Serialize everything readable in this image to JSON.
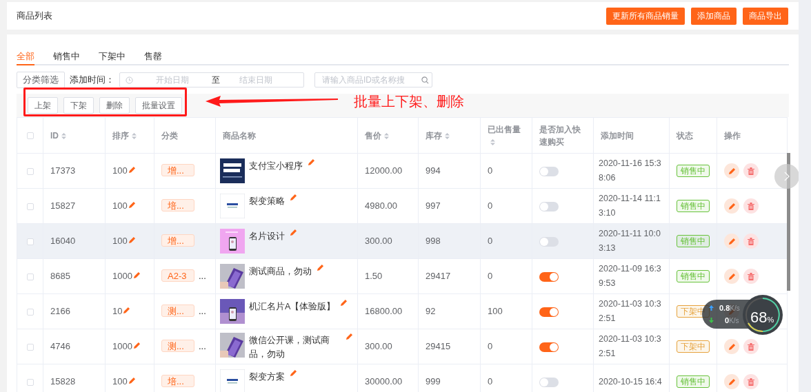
{
  "page_title": "商品列表",
  "header_buttons": [
    "更新所有商品销量",
    "添加商品",
    "商品导出"
  ],
  "tabs": [
    {
      "label": "全部",
      "selected": true
    },
    {
      "label": "销售中",
      "selected": false
    },
    {
      "label": "下架中",
      "selected": false
    },
    {
      "label": "售罄",
      "selected": false
    }
  ],
  "filters": {
    "category_button": "分类筛选",
    "time_label": "添加时间：",
    "start_placeholder": "开始日期",
    "range_separator": "至",
    "end_placeholder": "结束日期",
    "search_placeholder": "请输入商品ID或名称搜"
  },
  "batch_buttons": [
    "上架",
    "下架",
    "删除",
    "批量设置"
  ],
  "annotation": "批量上下架、删除",
  "table": {
    "select_all": {
      "checked": false
    },
    "columns": [
      {
        "label": "ID",
        "sortable": true
      },
      {
        "label": "排序",
        "sortable": true
      },
      {
        "label": "分类",
        "sortable": false
      },
      {
        "label": "商品名称",
        "sortable": false
      },
      {
        "label": "售价",
        "sortable": true
      },
      {
        "label": "库存",
        "sortable": true
      },
      {
        "label": "已出售量",
        "sortable": true
      },
      {
        "label": "是否加入快速购买",
        "sortable": false
      },
      {
        "label": "添加时间",
        "sortable": false
      },
      {
        "label": "状态",
        "sortable": false
      },
      {
        "label": "操作",
        "sortable": false
      }
    ],
    "rows": [
      {
        "id": "17373",
        "sort": "100",
        "category": "增...",
        "name": "支付宝小程序",
        "price": "12000.00",
        "stock": "994",
        "sold": "0",
        "quick_buy": false,
        "added": "2020-11-16 15:38:06",
        "status": {
          "text": "销售中",
          "color": "#67c23a"
        },
        "highlighted": false
      },
      {
        "id": "15827",
        "sort": "100",
        "category": "培...",
        "name": "裂变策略",
        "price": "4980.00",
        "stock": "997",
        "sold": "0",
        "quick_buy": false,
        "added": "2020-11-14 11:13:10",
        "status": {
          "text": "销售中",
          "color": "#67c23a"
        },
        "highlighted": false
      },
      {
        "id": "16040",
        "sort": "100",
        "category": "增...",
        "name": "名片设计",
        "price": "300.00",
        "stock": "998",
        "sold": "0",
        "quick_buy": false,
        "added": "2020-11-11 10:03:13",
        "status": {
          "text": "销售中",
          "color": "#67c23a"
        },
        "highlighted": true
      },
      {
        "id": "8685",
        "sort": "1000",
        "category": "A2-3",
        "more": "...",
        "name": "测试商品，勿动",
        "price": "1.50",
        "stock": "29417",
        "sold": "0",
        "quick_buy": true,
        "added": "2020-11-09 16:39:53",
        "status": {
          "text": "销售中",
          "color": "#67c23a"
        },
        "highlighted": false
      },
      {
        "id": "2166",
        "sort": "10",
        "category": "测...",
        "more": "...",
        "name": "机汇名片A【体验版】",
        "price": "16800.00",
        "stock": "92",
        "sold": "100",
        "quick_buy": true,
        "added": "2020-11-03 10:32:51",
        "status": {
          "text": "下架中",
          "color": "#e6a23c"
        },
        "highlighted": false
      },
      {
        "id": "4746",
        "sort": "1000",
        "category": "测...",
        "more": "...",
        "name": "微信公开课，测试商品，勿动",
        "price": "300.00",
        "stock": "29415",
        "sold": "0",
        "quick_buy": true,
        "added": "2020-11-03 10:32:51",
        "status": {
          "text": "下架中",
          "color": "#e6a23c"
        },
        "highlighted": false
      },
      {
        "id": "15828",
        "sort": "100",
        "category": "培...",
        "name": "裂变方案",
        "price": "30000.00",
        "stock": "999",
        "sold": "0",
        "quick_buy": false,
        "added": "2020-10-15 16:4",
        "status": {
          "text": "销售中",
          "color": "#67c23a"
        },
        "highlighted": false
      }
    ]
  },
  "network_widget": {
    "upload": "0.8",
    "upload_unit": "K/s",
    "download": "0",
    "download_unit": "K/s",
    "usage": "68",
    "usage_unit": "%"
  }
}
